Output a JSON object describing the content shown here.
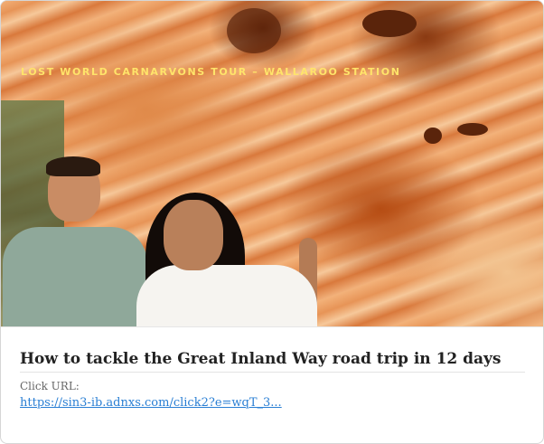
{
  "hero": {
    "caption": "LOST WORLD CARNARVONS TOUR – WALLAROO STATION",
    "caption_color": "#ffe46a"
  },
  "article": {
    "title": "How to tackle the Great Inland Way road trip in 12 days",
    "url_label": "Click URL:",
    "url": "https://sin3-ib.adnxs.com/click2?e=wqT_3...",
    "link_color": "#2a7fd4"
  }
}
